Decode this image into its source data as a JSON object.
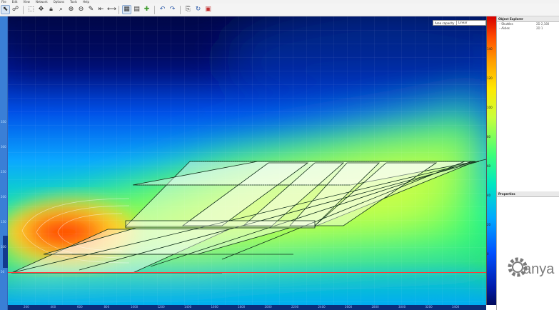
{
  "menu": [
    "File",
    "Edit",
    "View",
    "Network",
    "Options",
    "Tools",
    "Help"
  ],
  "toolbar_icons": [
    "select-icon",
    "network-icon",
    "zoom-region-icon",
    "pan-icon",
    "lock-icon",
    "zoom-fit-icon",
    "zoom-in-icon",
    "zoom-out-icon",
    "pencil-icon",
    "back-icon",
    "measure-icon",
    "graph-icon",
    "add-node-icon",
    "undo-icon",
    "redo-icon",
    "export-icon",
    "color-map-icon"
  ],
  "display_option": {
    "label": "Area capacity",
    "value": "Linear"
  },
  "object_explorer": {
    "title": "Object Explorer",
    "items": [
      {
        "name": "Shuttles",
        "value": "2D 2,180"
      },
      {
        "name": "Aisles",
        "value": "2D 1"
      }
    ]
  },
  "properties": {
    "title": "Properties"
  },
  "colorbar_ticks": [
    "140",
    "120",
    "100",
    "80",
    "60",
    "40",
    "20",
    "0"
  ],
  "x_ticks": [
    "200",
    "400",
    "600",
    "800",
    "1000",
    "1200",
    "1400",
    "1600",
    "1800",
    "2000",
    "2200",
    "2400",
    "2600",
    "2800",
    "3000",
    "3200",
    "3400"
  ],
  "left_ticks": [
    "50",
    "100",
    "150",
    "200",
    "250",
    "300",
    "350"
  ],
  "brand": {
    "text": "anya",
    "color": "#7a7a7a"
  },
  "colors": {
    "cursor": "#ff3a3a",
    "accent": "#3a7fd6"
  }
}
